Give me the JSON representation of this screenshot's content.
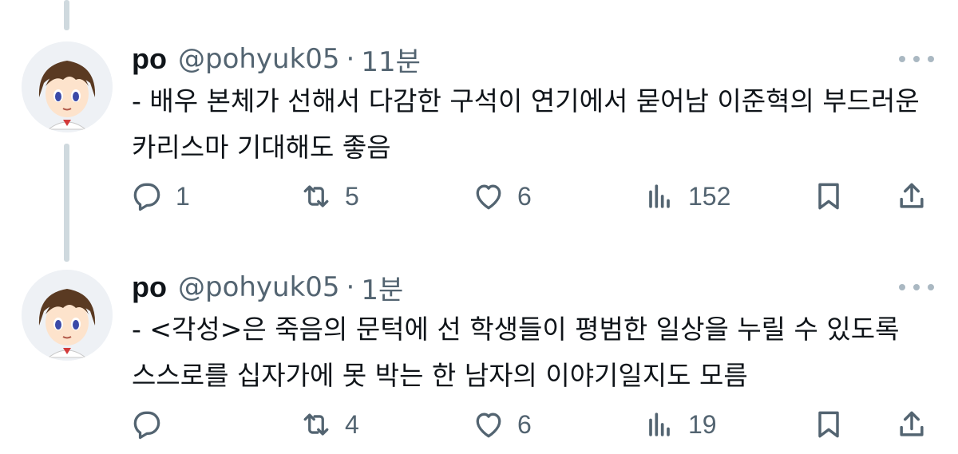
{
  "tweets": [
    {
      "name": "po",
      "handle": "@pohyuk05",
      "separator": "·",
      "time": "11분",
      "text": "- 배우 본체가 선해서 다감한 구석이 연기에서 묻어남 이준혁의 부드러운 카리스마 기대해도 좋음",
      "replies": "1",
      "reposts": "5",
      "likes": "6",
      "views": "152",
      "icons": {
        "reply": "reply-icon",
        "repost": "repost-icon",
        "like": "heart-icon",
        "views": "views-chart-icon",
        "bookmark": "bookmark-icon",
        "share": "share-icon",
        "more": "more-dots-icon"
      }
    },
    {
      "name": "po",
      "handle": "@pohyuk05",
      "separator": "·",
      "time": "1분",
      "text": "- <각성>은 죽음의 문턱에 선 학생들이 평범한 일상을 누릴 수 있도록 스스로를 십자가에 못 박는 한 남자의 이야기일지도 모름",
      "replies": "",
      "reposts": "4",
      "likes": "6",
      "views": "19",
      "icons": {
        "reply": "reply-icon",
        "repost": "repost-icon",
        "like": "heart-icon",
        "views": "views-chart-icon",
        "bookmark": "bookmark-icon",
        "share": "share-icon",
        "more": "more-dots-icon"
      }
    }
  ],
  "colors": {
    "text": "#0f1419",
    "secondary": "#536471",
    "thread_line": "#cfd9de"
  }
}
